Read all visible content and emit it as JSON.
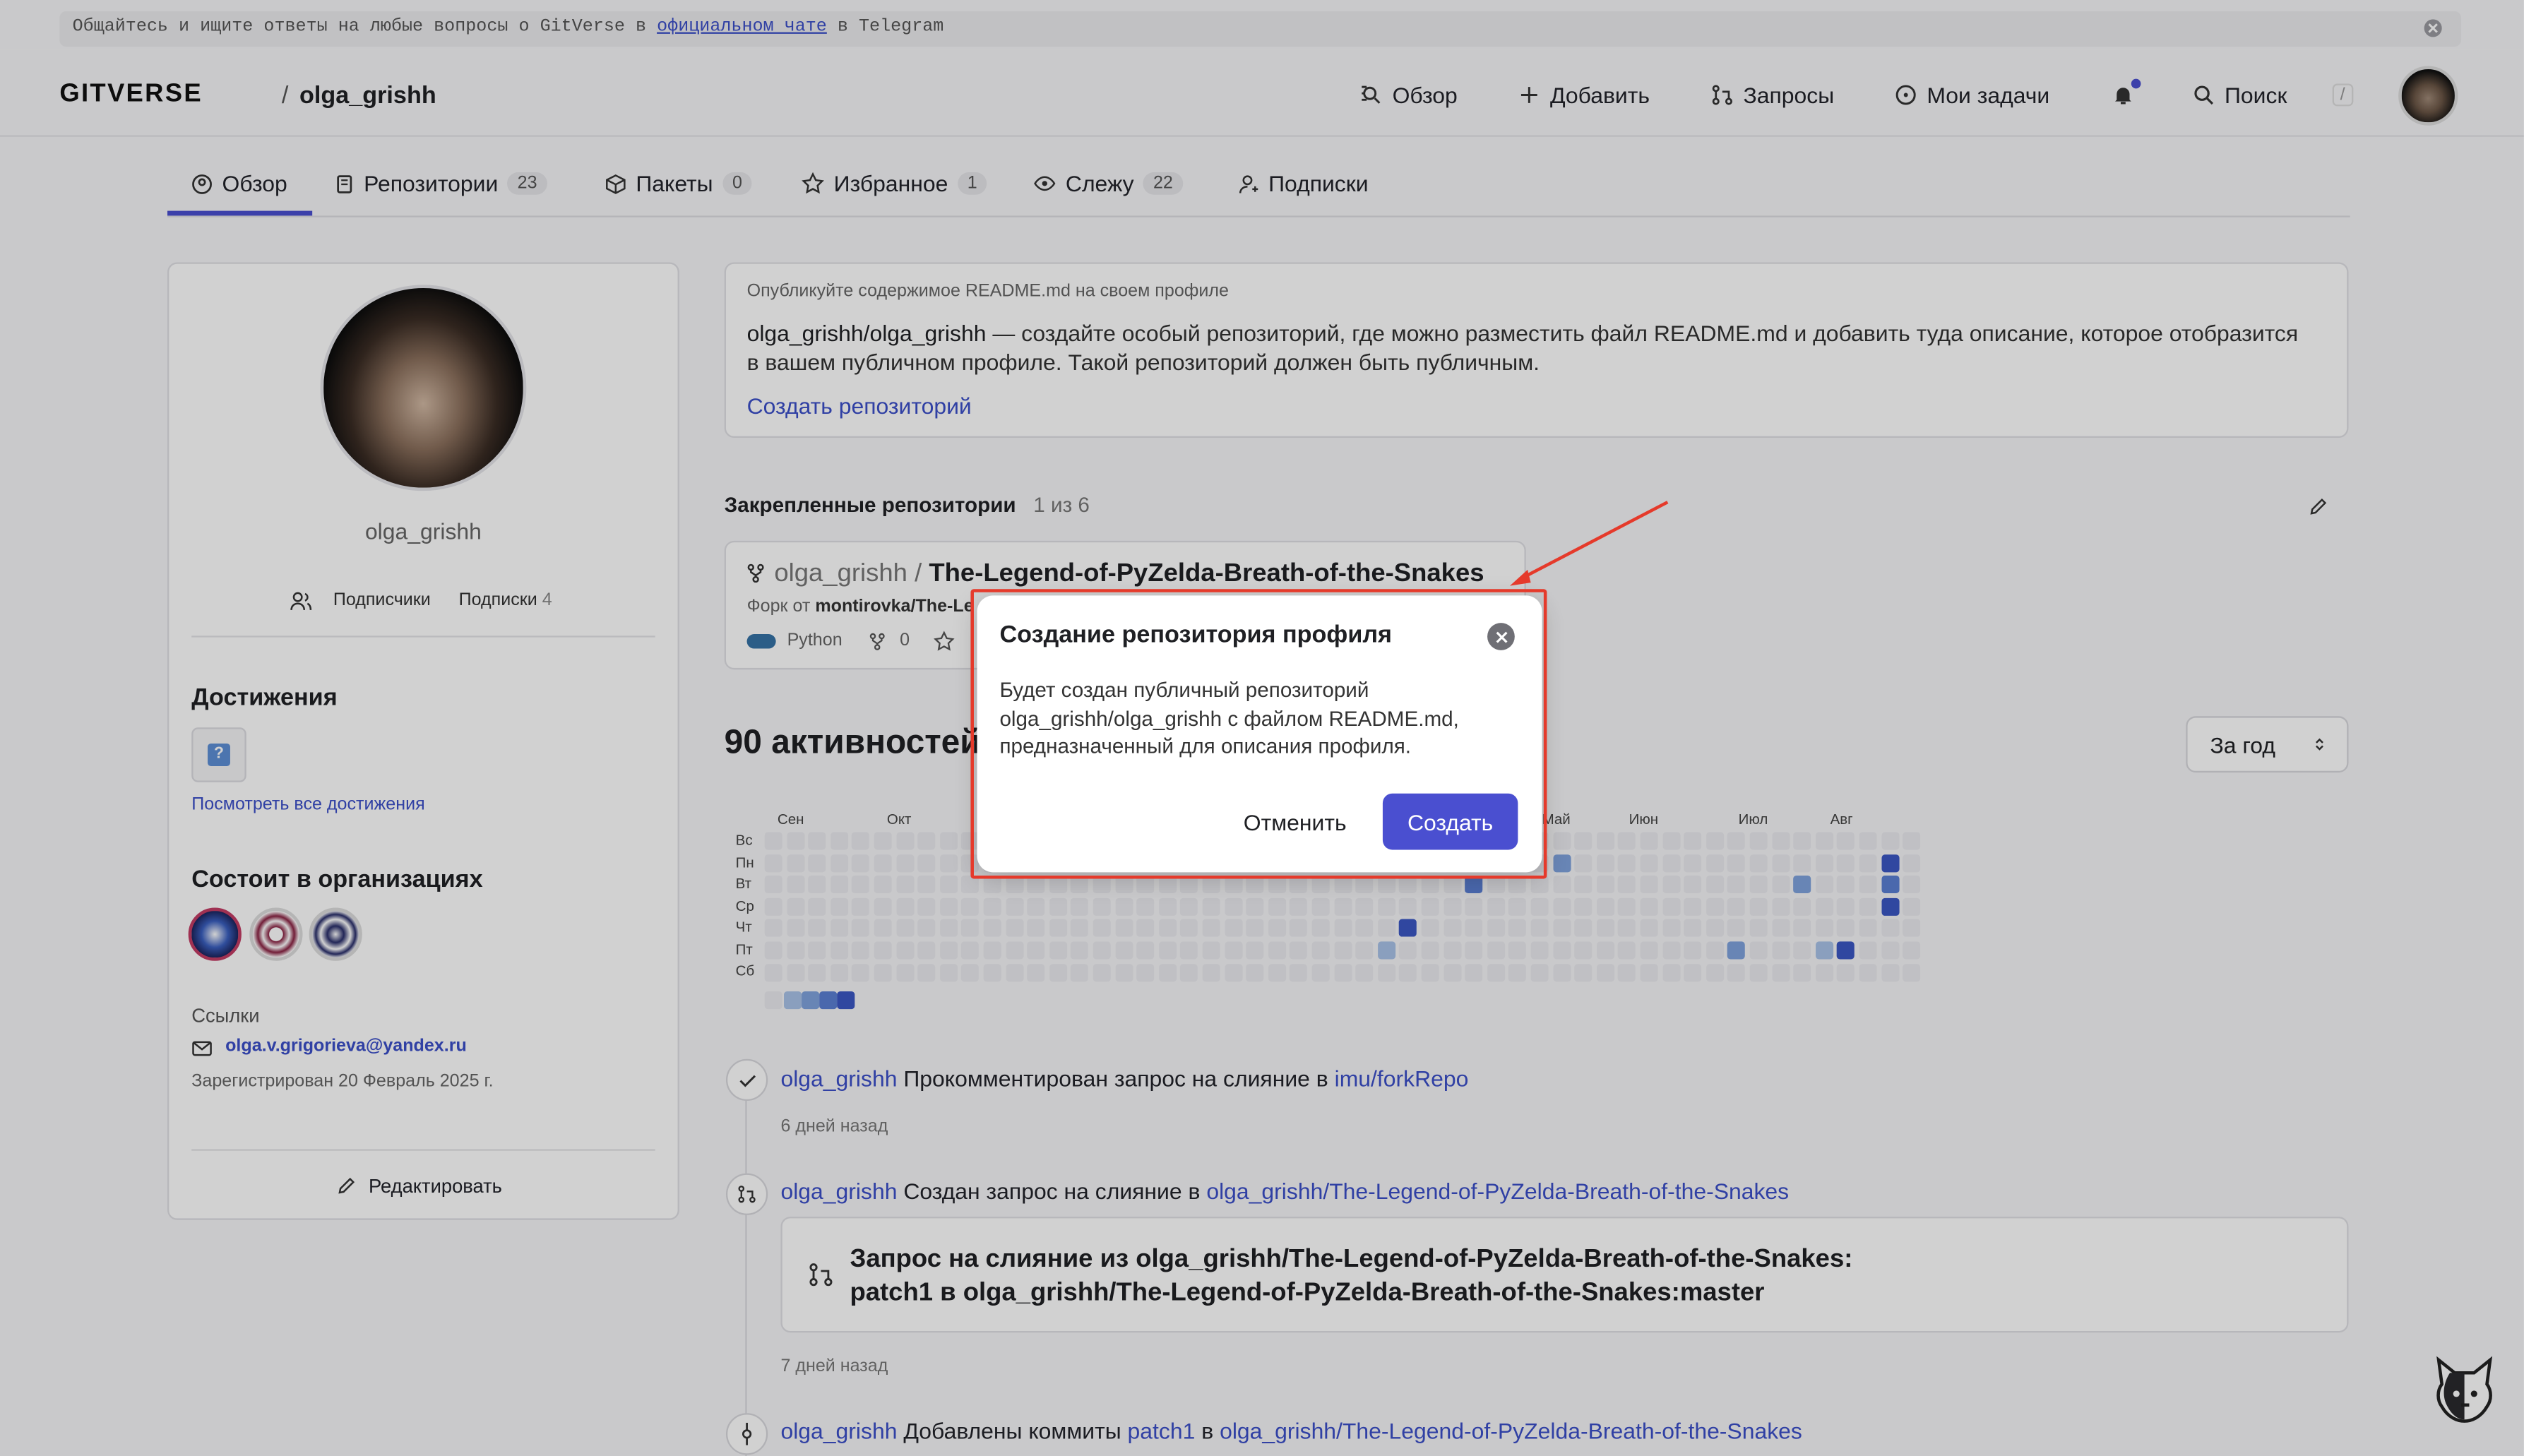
{
  "banner": {
    "text1": "Общайтесь и ищите ответы на любые вопросы о GitVerse в ",
    "link": "официальном чате",
    "text2": " в Telegram"
  },
  "header": {
    "logo": "GITVERSE",
    "sep": "/",
    "user": "olga_grishh",
    "nav": {
      "overview": "Обзор",
      "add": "Добавить",
      "requests": "Запросы",
      "tasks": "Мои задачи",
      "search": "Поиск",
      "search_key": "/"
    }
  },
  "tabs": {
    "overview": "Обзор",
    "repos": "Репозитории",
    "repos_count": "23",
    "packages": "Пакеты",
    "packages_count": "0",
    "favorites": "Избранное",
    "favorites_count": "1",
    "watching": "Слежу",
    "watching_count": "22",
    "subscriptions": "Подписки"
  },
  "profile": {
    "username": "olga_grishh",
    "followers": "Подписчики",
    "following": "Подписки",
    "following_count": "4",
    "achievements_title": "Достижения",
    "achievement_badge": "?",
    "achievements_link": "Посмотреть все достижения",
    "orgs_title": "Состоит в организациях",
    "links_title": "Ссылки",
    "email": "olga.v.grigorieva@yandex.ru",
    "registered": "Зарегистрирован 20 Февраль 2025 г.",
    "edit": "Редактировать"
  },
  "readme": {
    "hint": "Опубликуйте содержимое README.md на своем профиле",
    "repo": "olga_grishh/olga_grishh",
    "text": " — создайте особый репозиторий, где можно разместить файл README.md и добавить туда описание, которое отобразится в вашем публичном профиле. Такой репозиторий должен быть публичным.",
    "create_link": "Создать репозиторий"
  },
  "pinned": {
    "title": "Закрепленные репозитории",
    "count": "1 из 6",
    "owner": "olga_grishh",
    "sep": "/",
    "repo": "The-Legend-of-PyZelda-Breath-of-the-Snakes",
    "fork_label": "Форк от",
    "fork_src": "montirovka/The-Le",
    "lang": "Python",
    "lang_color": "#3572a5",
    "forks": "0"
  },
  "activity": {
    "title": "90 активностей",
    "period": "За год",
    "months": [
      "Сен",
      "Окт",
      "Май",
      "Июн",
      "Июл",
      "Авг"
    ],
    "days": [
      "Вс",
      "Пн",
      "Вт",
      "Ср",
      "Чт",
      "Пт",
      "Сб"
    ]
  },
  "events": [
    {
      "user": "olga_grishh",
      "action": " Прокомментирован запрос на слияние в ",
      "target": "imu/forkRepo",
      "time": "6 дней назад"
    },
    {
      "user": "olga_grishh",
      "action": " Создан запрос на слияние в ",
      "target": "olga_grishh/The-Legend-of-PyZelda-Breath-of-the-Snakes",
      "pr_line1": "Запрос на слияние из olga_grishh/The-Legend-of-PyZelda-Breath-of-the-Snakes:",
      "pr_line2": "patch1 в olga_grishh/The-Legend-of-PyZelda-Breath-of-the-Snakes:master",
      "time": "7 дней назад"
    },
    {
      "user": "olga_grishh",
      "action": " Добавлены коммиты ",
      "branch": "patch1",
      "mid": " в ",
      "target": "olga_grishh/The-Legend-of-PyZelda-Breath-of-the-Snakes"
    }
  ],
  "modal": {
    "title": "Создание репозитория профиля",
    "body": "Будет создан публичный репозиторий olga_grishh/olga_grishh с файлом README.md, предназначенный для описания профиля.",
    "cancel": "Отменить",
    "create": "Создать"
  },
  "colors": {
    "accent": "#4a4fd0",
    "link": "#3b4fc8",
    "annotation": "#e53a2b"
  }
}
